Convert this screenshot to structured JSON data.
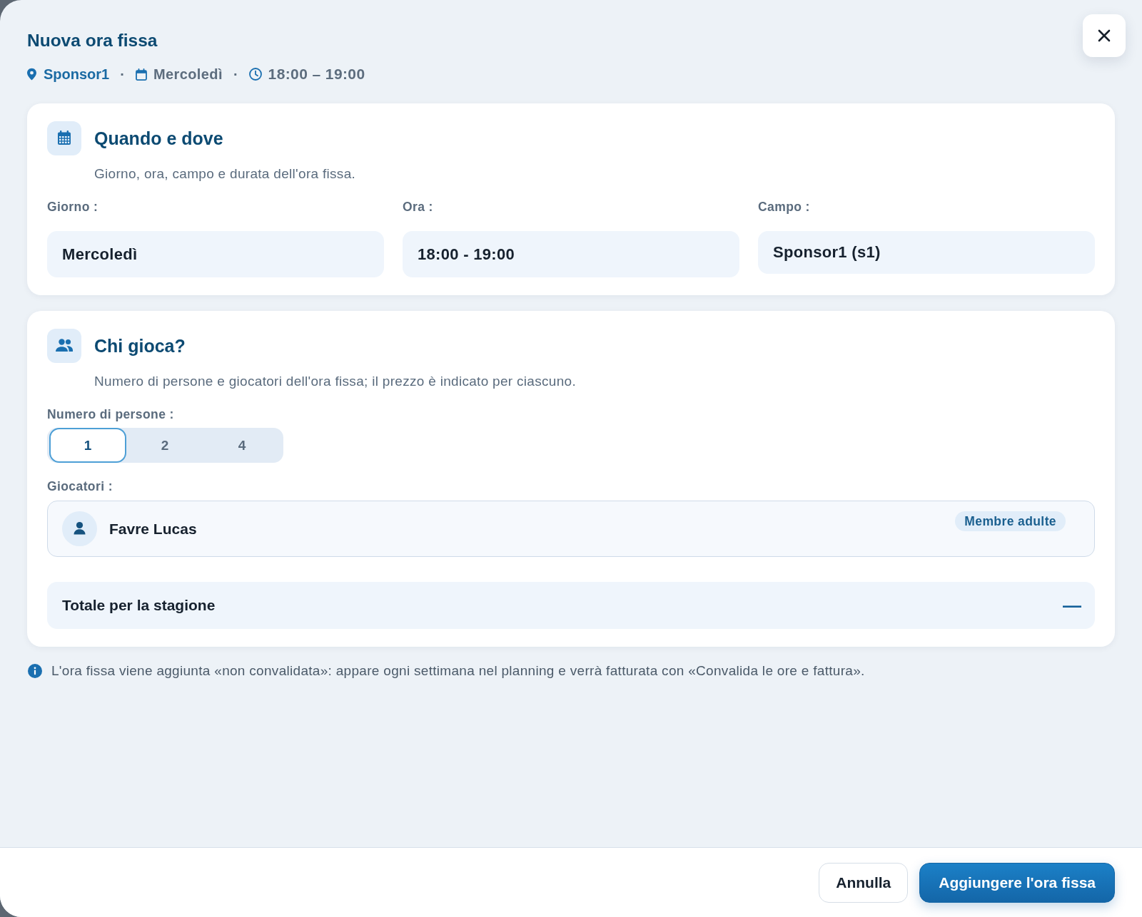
{
  "dialog": {
    "title": "Nuova ora fissa",
    "meta": [
      {
        "kind": "place",
        "text": "Sponsor1"
      },
      {
        "kind": "day",
        "text": "Mercoledì"
      },
      {
        "kind": "time",
        "text": "18:00 – 19:00"
      }
    ],
    "separators": [
      "·",
      "·"
    ]
  },
  "sections": [
    {
      "kind": "when",
      "title": "Quando e dove",
      "subtitle": "Giorno, ora, campo e durata dell'ora fissa.",
      "fields": [
        {
          "kind": "input",
          "label": "Giorno :",
          "value": "Mercoledì"
        },
        {
          "kind": "input",
          "label": "Ora :",
          "value": "18:00 - 19:00"
        },
        {
          "kind": "select",
          "label": "Campo :",
          "value": "Sponsor1 (s1)"
        }
      ]
    },
    {
      "kind": "who",
      "title": "Chi gioca?",
      "subtitle": "Numero di persone e giocatori dell'ora fissa; il prezzo è indicato per ciascuno.",
      "people_count": {
        "label": "Numero di persone :",
        "options": [
          {
            "label": "1",
            "selected": true
          },
          {
            "label": "2",
            "selected": false
          },
          {
            "label": "4",
            "selected": false
          }
        ]
      },
      "players": {
        "label": "Giocatori :",
        "items": [
          {
            "name": "Favre Lucas",
            "badge": "Membre adulte"
          }
        ]
      },
      "total": {
        "label": "Totale per la stagione",
        "value": "—"
      }
    }
  ],
  "info_note": "L'ora fissa viene aggiunta «non convalidata»: appare ogni settimana nel planning e verrà fatturata con «Convalida le ore e fattura».",
  "footer": {
    "buttons": [
      {
        "kind": "secondary",
        "label": "Annulla"
      },
      {
        "kind": "primary",
        "label": "Aggiungere l'ora fissa"
      }
    ]
  }
}
